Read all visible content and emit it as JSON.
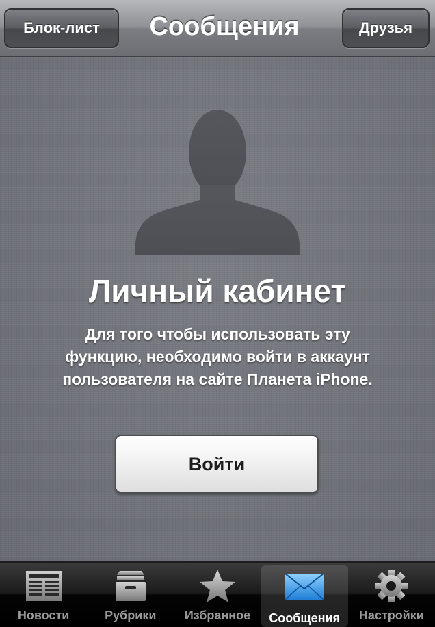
{
  "navbar": {
    "title": "Сообщения",
    "left_button": "Блок-лист",
    "right_button": "Друзья"
  },
  "main": {
    "heading": "Личный кабинет",
    "description": "Для того чтобы использовать эту функцию, необходимо войти в аккаунт пользователя на сайте Планета iPhone.",
    "login_button": "Войти",
    "avatar_icon": "person-silhouette-icon"
  },
  "tabbar": {
    "active_index": 3,
    "tabs": [
      {
        "label": "Новости",
        "icon": "newspaper-icon"
      },
      {
        "label": "Рубрики",
        "icon": "archive-box-icon"
      },
      {
        "label": "Избранное",
        "icon": "star-icon"
      },
      {
        "label": "Сообщения",
        "icon": "envelope-icon"
      },
      {
        "label": "Настройки",
        "icon": "gear-icon"
      }
    ]
  },
  "colors": {
    "accent_blue": "#3a9de6",
    "inactive_tab": "#9a9a9a"
  }
}
